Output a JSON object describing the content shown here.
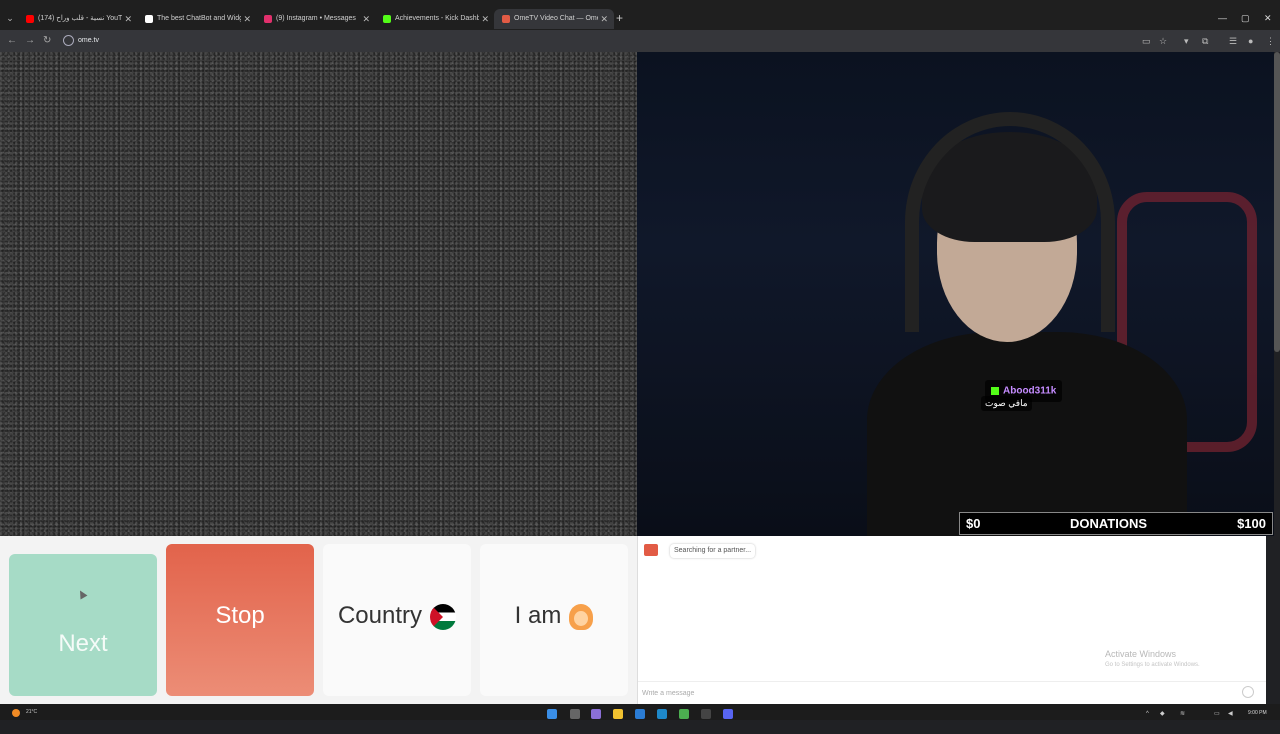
{
  "browser": {
    "tabs": [
      {
        "title": "نسية - قلب وراح (174) YouTube",
        "favicon_color": "#ff0000",
        "active": false
      },
      {
        "title": "The best ChatBot and Widgets",
        "favicon_color": "#ffffff",
        "active": false
      },
      {
        "title": "(9) Instagram • Messages",
        "favicon_color": "#e1306c",
        "active": false
      },
      {
        "title": "Achievements - Kick Dashboard",
        "favicon_color": "#53fc18",
        "active": false
      },
      {
        "title": "OmeTV Video Chat — Ome",
        "favicon_color": "#e25b45",
        "active": true
      }
    ],
    "new_tab": "+",
    "url": "ome.tv"
  },
  "stream_overlay": {
    "username": "Abood311k",
    "subtitle": "مافي صوت",
    "donations": {
      "min": "$0",
      "label": "DONATIONS",
      "max": "$100",
      "progress": 0.0
    }
  },
  "controls": {
    "next_label": "Next",
    "stop_label": "Stop",
    "country_label": "Country",
    "iam_label": "I am",
    "country_flag": "jordan-flag",
    "iam_avatar": "woman-emoji",
    "colors": {
      "next": "#a6dbc6",
      "stop": "#e2634b"
    }
  },
  "chat": {
    "status": "Searching for a partner...",
    "input_placeholder": "Write a message",
    "watermark_title": "Activate Windows",
    "watermark_sub": "Go to Settings to activate Windows."
  },
  "taskbar": {
    "temperature": "21°C",
    "time": "9:00 PM"
  }
}
